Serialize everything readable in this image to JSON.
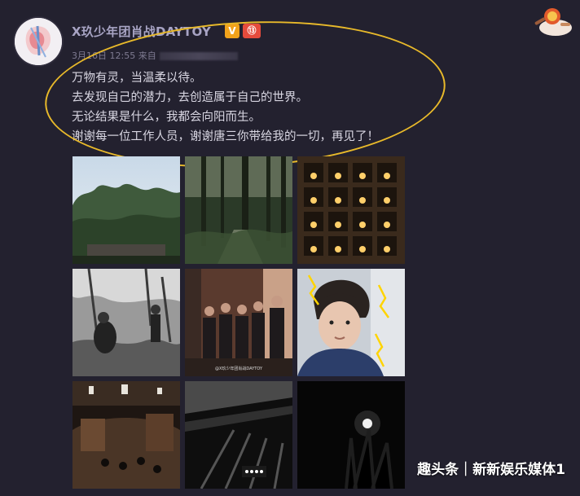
{
  "post": {
    "username": "X玖少年团肖战DAYTOY",
    "verified_badge": "V",
    "vip_badge": "⑬",
    "timestamp": "3月16日 12:55 来自",
    "lines": [
      "万物有灵，当温柔以待。",
      "去发现自己的潜力，去创造属于自己的世界。",
      "无论结果是什么，我都会向阳而生。",
      "谢谢每一位工作人员，谢谢唐三你带给我的一切，再见了！"
    ]
  },
  "photos": [
    {
      "name": "forest-sky-photo",
      "scene": "forest-sky"
    },
    {
      "name": "dark-forest-path-photo",
      "scene": "dark-forest"
    },
    {
      "name": "candle-shelves-photo",
      "scene": "candle-shelves"
    },
    {
      "name": "bw-crew-outdoor-photo",
      "scene": "bw-crew"
    },
    {
      "name": "cast-group-photo",
      "scene": "cast-group"
    },
    {
      "name": "selfie-photo",
      "scene": "selfie"
    },
    {
      "name": "studio-set-photo",
      "scene": "studio-set"
    },
    {
      "name": "ceiling-rig-photo",
      "scene": "ceiling-rig"
    },
    {
      "name": "night-moon-photo",
      "scene": "night-moon"
    }
  ],
  "photo_watermark": "@X玖少年团肖战DAYTOY",
  "source_watermark": "趣头条｜新新娱乐媒体1",
  "colors": {
    "background": "#23212f",
    "username": "#a8a4c4",
    "highlight_oval": "#e8b92a",
    "verified": "#f1a21b",
    "vip": "#e54b3c"
  }
}
